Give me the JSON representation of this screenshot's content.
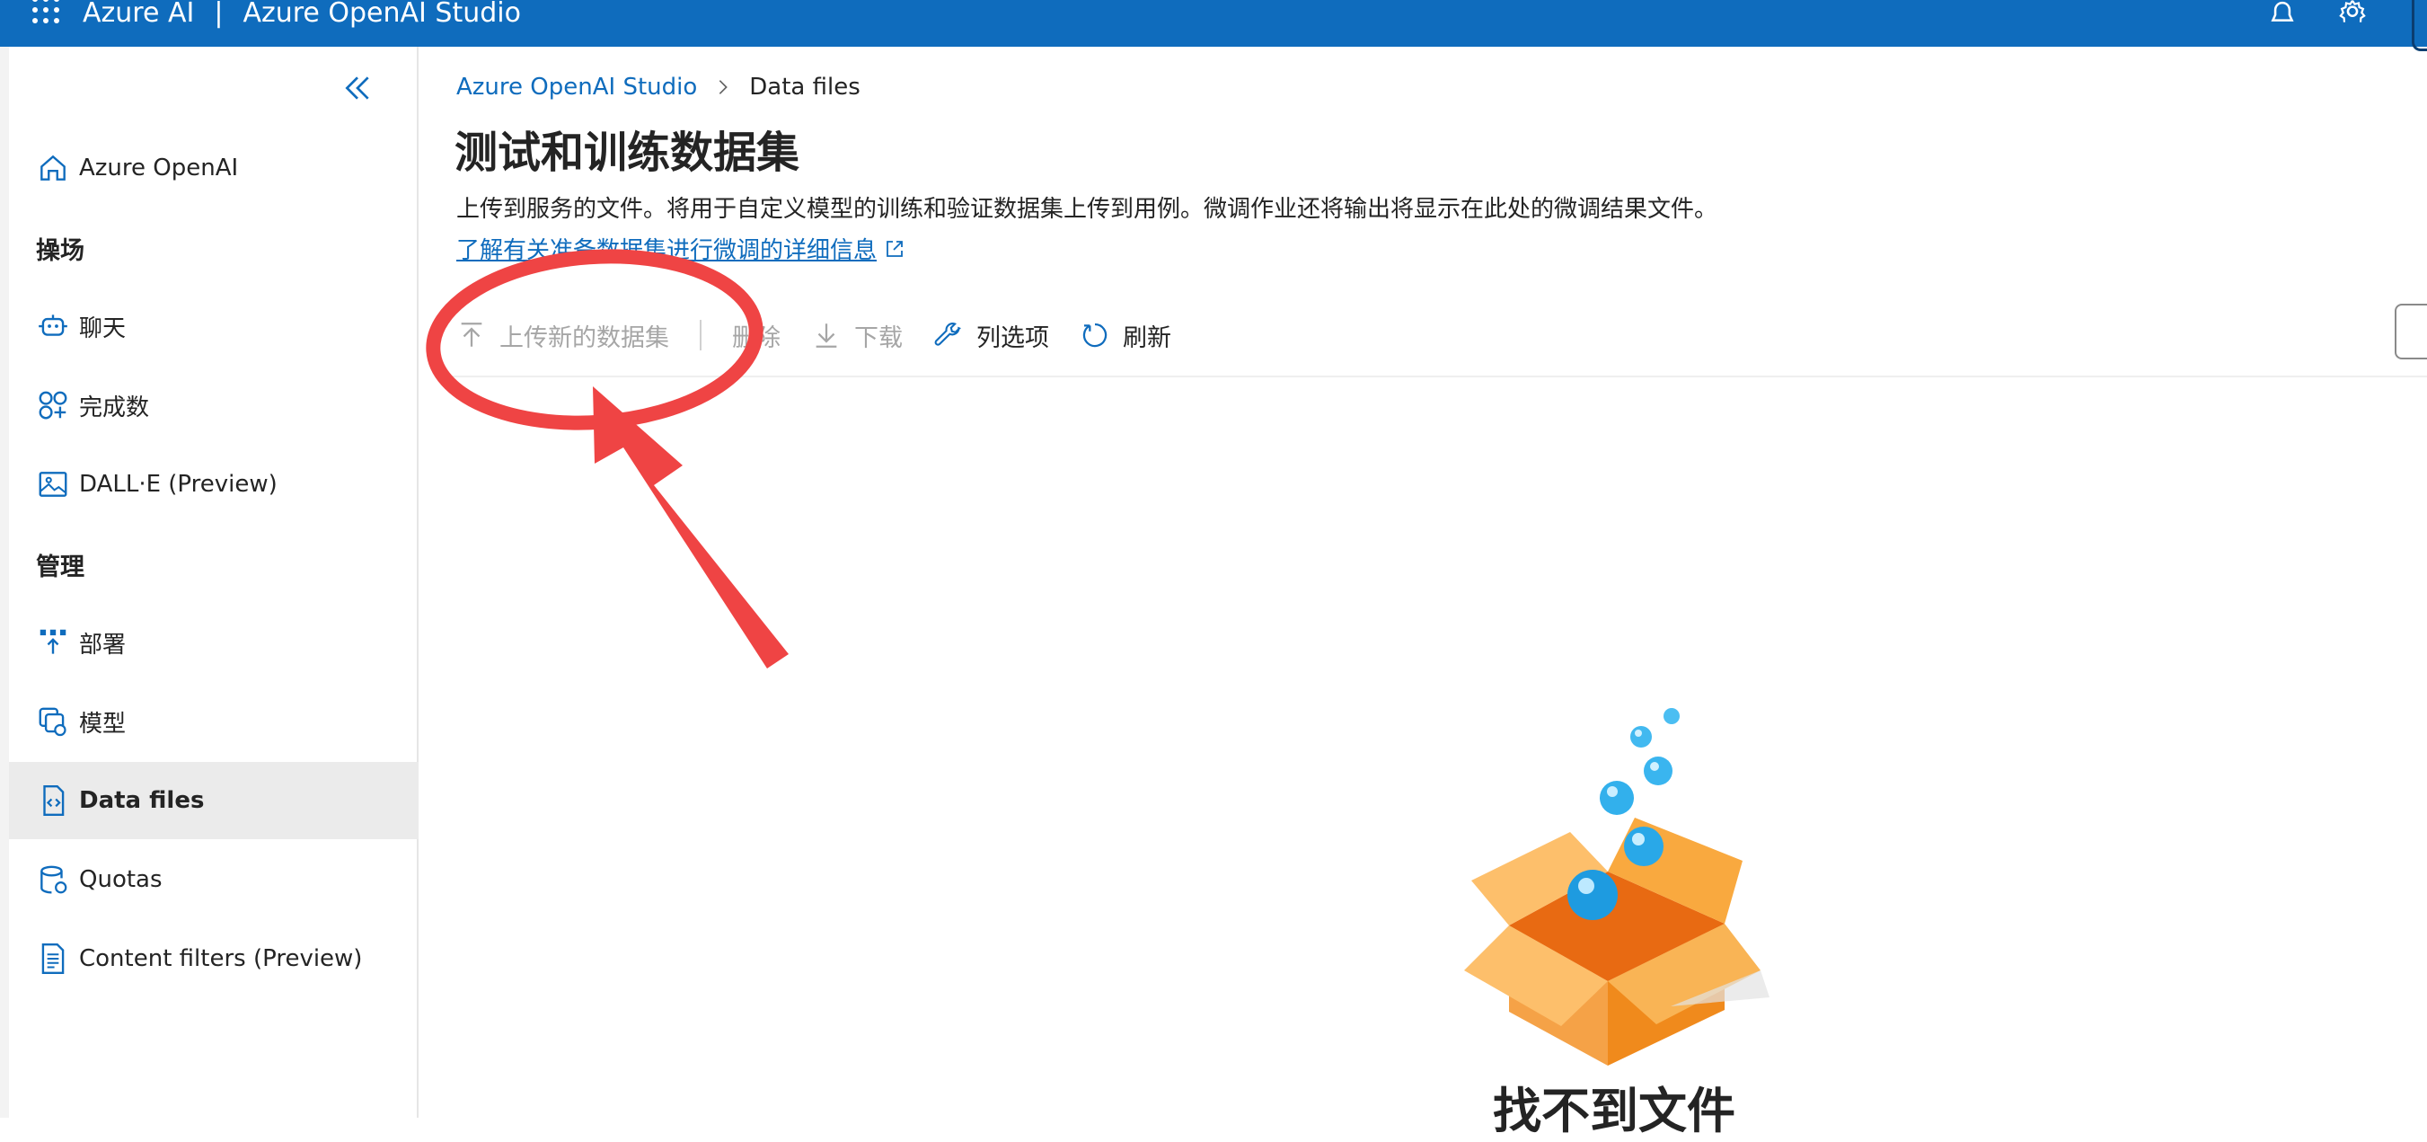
{
  "topbar": {
    "app_name": "Azure AI",
    "separator": "|",
    "studio_name": "Azure OpenAI Studio",
    "icons": [
      "waffle-icon",
      "bell-icon",
      "gear-icon"
    ],
    "color": "#0F6CBD"
  },
  "sidebar": {
    "collapse_icon": "double-chevron-left-icon",
    "home": {
      "label": "Azure OpenAI",
      "icon": "home-icon"
    },
    "playground_heading": "操场",
    "playground_items": [
      {
        "label": "聊天",
        "icon": "chat-bot-icon"
      },
      {
        "label": "完成数",
        "icon": "completions-icon"
      },
      {
        "label": "DALL·E (Preview)",
        "icon": "image-icon"
      }
    ],
    "manage_heading": "管理",
    "manage_items": [
      {
        "label": "部署",
        "icon": "deploy-icon"
      },
      {
        "label": "模型",
        "icon": "models-icon"
      },
      {
        "label": "Data files",
        "icon": "code-file-icon",
        "active": true
      },
      {
        "label": "Quotas",
        "icon": "quota-icon"
      },
      {
        "label": "Content filters (Preview)",
        "icon": "content-filter-icon"
      }
    ]
  },
  "breadcrumb": {
    "root": "Azure OpenAI Studio",
    "current": "Data files"
  },
  "page": {
    "title": "测试和训练数据集",
    "description": "上传到服务的文件。将用于自定义模型的训练和验证数据集上传到用例。微调作业还将输出将显示在此处的微调结果文件。",
    "learn_more": "了解有关准备数据集进行微调的详细信息"
  },
  "toolbar": {
    "upload": {
      "label": "上传新的数据集",
      "icon": "upload-arrow-icon",
      "disabled": true
    },
    "delete": {
      "label": "删除",
      "icon": "delete-icon",
      "disabled": true
    },
    "download": {
      "label": "下载",
      "icon": "download-arrow-icon",
      "disabled": true
    },
    "columns": {
      "label": "列选项",
      "icon": "wrench-icon",
      "disabled": false
    },
    "refresh": {
      "label": "刷新",
      "icon": "refresh-icon",
      "disabled": false
    }
  },
  "annotation": {
    "color": "#EF4444",
    "shapes": [
      "circle-highlight",
      "arrow-pointer"
    ]
  },
  "empty_state": {
    "title": "找不到文件",
    "illustration": "open-box-bubbles-illustration"
  }
}
